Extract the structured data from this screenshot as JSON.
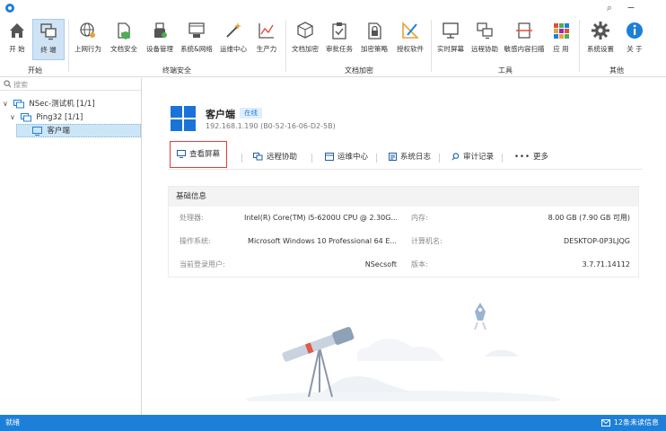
{
  "window": {
    "minimize": "−",
    "search": "⌕"
  },
  "ribbon": {
    "groups": [
      {
        "label": "开始"
      },
      {
        "label": "终端安全"
      },
      {
        "label": "文档加密"
      },
      {
        "label": "工具"
      },
      {
        "label": "其他"
      }
    ],
    "buttons": [
      {
        "label": "开 始",
        "icon": "home-icon"
      },
      {
        "label": "终 端",
        "icon": "terminal-icon"
      },
      {
        "label": "上网行为",
        "icon": "globe-icon"
      },
      {
        "label": "文档安全",
        "icon": "doc-shield-icon"
      },
      {
        "label": "设备管理",
        "icon": "usb-icon"
      },
      {
        "label": "系统&网络",
        "icon": "system-network-icon"
      },
      {
        "label": "运维中心",
        "icon": "wand-icon"
      },
      {
        "label": "生产力",
        "icon": "chart-icon"
      },
      {
        "label": "文档加密",
        "icon": "cube-icon"
      },
      {
        "label": "审批任务",
        "icon": "clipboard-check-icon"
      },
      {
        "label": "加密策略",
        "icon": "lock-doc-icon"
      },
      {
        "label": "授权软件",
        "icon": "pencil-ruler-icon"
      },
      {
        "label": "实时屏幕",
        "icon": "monitor-icon"
      },
      {
        "label": "远程协助",
        "icon": "remote-icon"
      },
      {
        "label": "敏感内容扫描",
        "icon": "scan-icon"
      },
      {
        "label": "应 用",
        "icon": "apps-icon"
      },
      {
        "label": "系统设置",
        "icon": "gear-icon"
      },
      {
        "label": "关 于",
        "icon": "info-icon"
      }
    ]
  },
  "left_panel": {
    "search_placeholder": "搜索",
    "tree": [
      {
        "label": "NSec-测试机",
        "count": "[1/1]"
      },
      {
        "label": "Ping32",
        "count": "[1/1]"
      },
      {
        "label": "客户端",
        "count": ""
      }
    ]
  },
  "client": {
    "name": "客户端",
    "status": "在线",
    "ip_mac": "192.168.1.190  (B0-52-16-06-D2-5B)"
  },
  "actions": [
    {
      "label": "查看屏幕",
      "icon": "monitor-icon"
    },
    {
      "label": "远程协助",
      "icon": "remote-icon"
    },
    {
      "label": "运维中心",
      "icon": "toolbox-icon"
    },
    {
      "label": "系统日志",
      "icon": "log-icon"
    },
    {
      "label": "审计记录",
      "icon": "search-icon"
    },
    {
      "label": "更多",
      "icon": "more-icon"
    }
  ],
  "info": {
    "title": "基础信息",
    "rows": [
      {
        "k1": "处理器:",
        "v1": "Intel(R) Core(TM) i5-6200U CPU @ 2.30G...",
        "k2": "内存:",
        "v2": "8.00 GB (7.90 GB 可用)"
      },
      {
        "k1": "操作系统:",
        "v1": "Microsoft Windows 10 Professional 64 E...",
        "k2": "计算机名:",
        "v2": "DESKTOP-0P3LJQG"
      },
      {
        "k1": "当前登录用户:",
        "v1": "NSecsoft",
        "k2": "版本:",
        "v2": "3.7.71.14112"
      }
    ]
  },
  "status": {
    "left": "就绪",
    "right": "12条未读信息"
  },
  "colors": {
    "accent": "#1e7fd8",
    "highlight": "#e23b3b"
  }
}
